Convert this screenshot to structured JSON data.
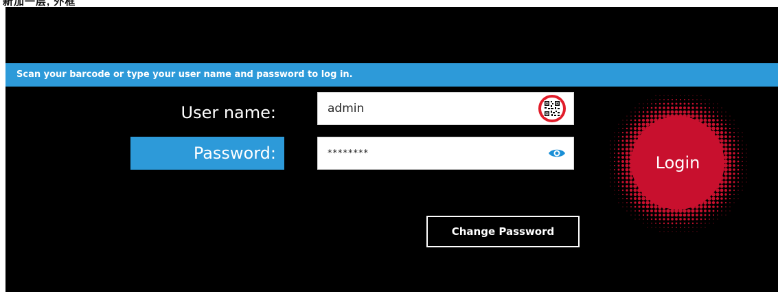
{
  "top_strip": {
    "text_fragment": "新加一层, 外框"
  },
  "banner": {
    "text": "Scan your barcode or type your user name and password to log in."
  },
  "form": {
    "username_label": "User name:",
    "username_value": "admin",
    "password_label": "Password:",
    "password_value": "********"
  },
  "buttons": {
    "change_password": "Change Password",
    "login": "Login"
  },
  "icons": {
    "barcode": "qr-code-icon",
    "show_password": "eye-icon"
  },
  "colors": {
    "accent": "#2d9ad9",
    "highlight_ring": "#e11d2a",
    "login": "#c8102e",
    "background": "#000000"
  }
}
